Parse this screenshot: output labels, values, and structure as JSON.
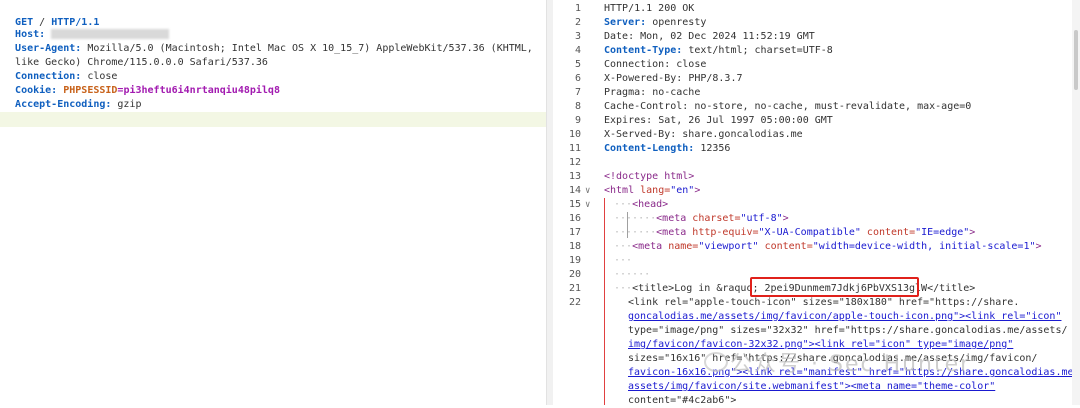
{
  "request": {
    "method": "GET",
    "path": "/",
    "protocol": "HTTP/1.1",
    "headers": [
      {
        "key": "Host:",
        "value": ""
      },
      {
        "key": "User-Agent:",
        "value": "Mozilla/5.0 (Macintosh; Intel Mac OS X 10_15_7) AppleWebKit/537.36 (KHTML,"
      },
      {
        "key": "",
        "value": "like Gecko) Chrome/115.0.0.0 Safari/537.36"
      },
      {
        "key": "Connection:",
        "value": "close"
      },
      {
        "key": "Cookie:",
        "value": ""
      },
      {
        "key": "Accept-Encoding:",
        "value": "gzip"
      }
    ],
    "cookie_name": "PHPSESSID",
    "cookie_value": "=pi3heftu6i4nrtanqiu48pilq8"
  },
  "response": {
    "line_numbers": [
      "1",
      "2",
      "3",
      "4",
      "5",
      "6",
      "7",
      "8",
      "9",
      "10",
      "11",
      "12",
      "13",
      "14",
      "15",
      "16",
      "17",
      "18",
      "19",
      "20",
      "21",
      "22"
    ],
    "headers": [
      {
        "key": "HTTP/1.1 200 OK",
        "value": ""
      },
      {
        "key": "Server:",
        "value": "openresty"
      },
      {
        "key": "Date:",
        "value": "Mon, 02 Dec 2024 11:52:19 GMT"
      },
      {
        "key": "Content-Type:",
        "value": "text/html; charset=UTF-8"
      },
      {
        "key": "Connection:",
        "value": "close"
      },
      {
        "key": "X-Powered-By:",
        "value": "PHP/8.3.7"
      },
      {
        "key": "Pragma:",
        "value": "no-cache"
      },
      {
        "key": "Cache-Control:",
        "value": "no-store, no-cache, must-revalidate, max-age=0"
      },
      {
        "key": "Expires:",
        "value": "Sat, 26 Jul 1997 05:00:00 GMT"
      },
      {
        "key": "X-Served-By:",
        "value": "share.goncalodias.me"
      },
      {
        "key": "Content-Length:",
        "value": "12356"
      }
    ],
    "html": {
      "doctype": "<!doctype html>",
      "html_open_tag": "<html",
      "html_lang_attr": "lang=",
      "html_lang_val": "\"en\"",
      "head": "<head>",
      "meta_charset_attr": "charset=",
      "meta_charset_val": "\"utf-8\"",
      "meta_http_attr": "http-equiv=",
      "meta_http_val": "\"X-UA-Compatible\"",
      "meta_content_attr": "content=",
      "meta_content_val": "\"IE=edge\"",
      "meta_name_attr": "name=",
      "meta_name_val": "\"viewport\"",
      "meta_vp_content_val": "\"width=device-width, initial-scale=1\"",
      "title_prefix": "<title>Log in &raquo; ",
      "title_token": "2pei9Dunmem7Jdkj6PbVXS13glW",
      "title_suffix": "</title>",
      "link_lines": [
        "<link rel=\"apple-touch-icon\" sizes=\"180x180\" href=\"https://share.",
        "goncalodias.me/assets/img/favicon/apple-touch-icon.png\"><link rel=\"icon\"",
        "type=\"image/png\" sizes=\"32x32\" href=\"https://share.goncalodias.me/assets/",
        "img/favicon/favicon-32x32.png\"><link rel=\"icon\" type=\"image/png\"",
        "sizes=\"16x16\" href=\"https://share.goncalodias.me/assets/img/favicon/",
        "favicon-16x16.png\"><link rel=\"manifest\" href=\"https://share.goncalodias.me/",
        "assets/img/favicon/site.webmanifest\"><meta name=\"theme-color\"",
        "content=\"#4c2ab6\">"
      ]
    }
  },
  "watermark": "公众号 · Sec Hunter"
}
